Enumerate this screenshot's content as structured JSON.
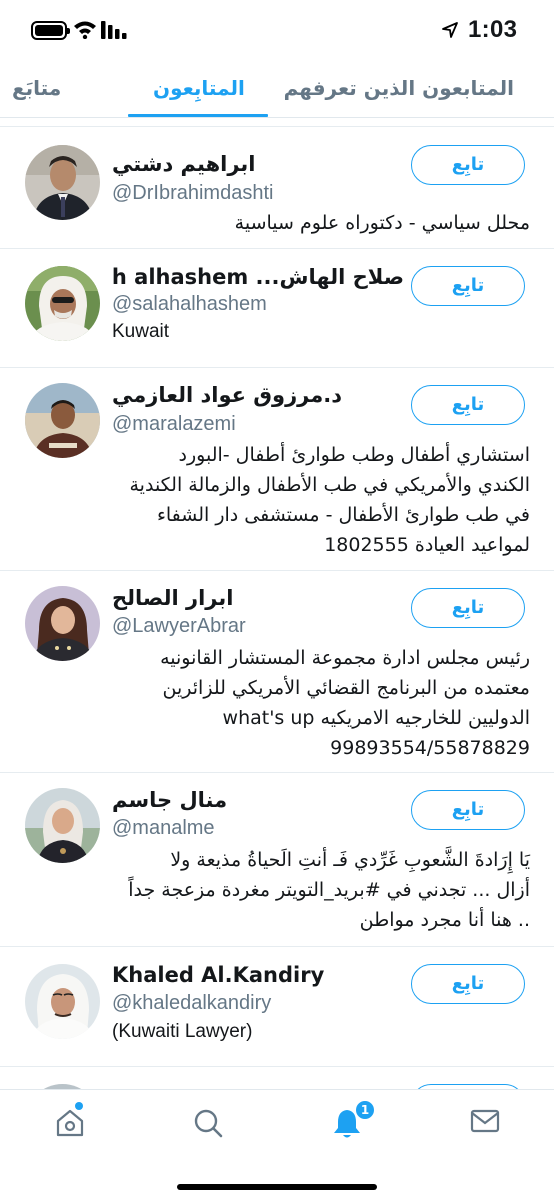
{
  "status_bar": {
    "time": "1:03"
  },
  "tabs": {
    "known": "المتابعون الذين تعرفهم",
    "followers": "المتابِعون",
    "following": "متابَع"
  },
  "follow_label": "تابِع",
  "users": [
    {
      "name": "ابراهيم دشتي",
      "handle": "@DrIbrahimdashti",
      "bio": [
        "محلل سياسي - دكتوراه علوم سياسية"
      ]
    },
    {
      "name": "صلاح الهاش... salah alhashem",
      "handle": "@salahalhashem",
      "bio": [
        "Kuwait"
      ]
    },
    {
      "name": "د.مرزوق عواد العازمي",
      "handle": "@maralazemi",
      "bio": [
        "استشاري أطفال وطب طوارئ أطفال -البورد",
        "الكندي والأمريكي في طب الأطفال والزمالة الكندية",
        "في طب طوارئ الأطفال - مستشفى دار الشفاء",
        "لمواعيد العيادة 1802555"
      ]
    },
    {
      "name": "ابرار الصالح",
      "handle": "@LawyerAbrar",
      "bio": [
        "رئيس مجلس ادارة مجموعة المستشار القانونيه",
        "معتمده من البرنامج القضائي الأمريكي للزائرين",
        "الدوليين للخارجيه الامريكيه what's up",
        "99893554/55878829"
      ]
    },
    {
      "name": "منال جاسم",
      "handle": "@manalme",
      "bio": [
        "يَا إِرَادةَ الشَّعوبِ غَرِّدي فَـ أنتِ الَحياةُ مذيعة ولا",
        "أزال ... تجدني في #بريد_التويتر مغردة مزعجة جداً",
        ".. هنا أنا مجرد مواطن"
      ]
    },
    {
      "name": "Khaled Al.Kandiry",
      "handle": "@khaledalkandiry",
      "bio": [
        "(Kuwaiti Lawyer)"
      ]
    }
  ],
  "bottom_nav": {
    "notification_count": "1"
  },
  "colors": {
    "accent": "#1da1f2",
    "secondary_text": "#657786",
    "divider": "#e6ecf0"
  }
}
